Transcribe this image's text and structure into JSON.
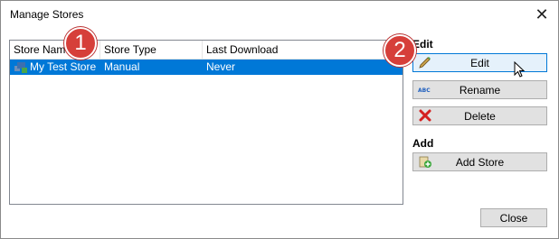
{
  "window": {
    "title": "Manage Stores",
    "close_glyph": "✕"
  },
  "list": {
    "columns": [
      "Store Name",
      "Store Type",
      "Last Download"
    ],
    "rows": [
      {
        "name": "My Test Store",
        "type": "Manual",
        "last_download": "Never",
        "icon": "store-icon"
      }
    ]
  },
  "edit_group": {
    "label": "Edit",
    "buttons": {
      "edit": {
        "label": "Edit",
        "icon": "pencil-icon"
      },
      "rename": {
        "label": "Rename",
        "icon": "abc-icon"
      },
      "delete": {
        "label": "Delete",
        "icon": "red-x-icon"
      }
    }
  },
  "add_group": {
    "label": "Add",
    "buttons": {
      "add_store": {
        "label": "Add Store",
        "icon": "add-store-icon"
      }
    }
  },
  "footer": {
    "close_label": "Close"
  },
  "callouts": [
    {
      "number": "1"
    },
    {
      "number": "2"
    }
  ],
  "colors": {
    "selection": "#0078d7",
    "badge": "#d63f3a"
  }
}
